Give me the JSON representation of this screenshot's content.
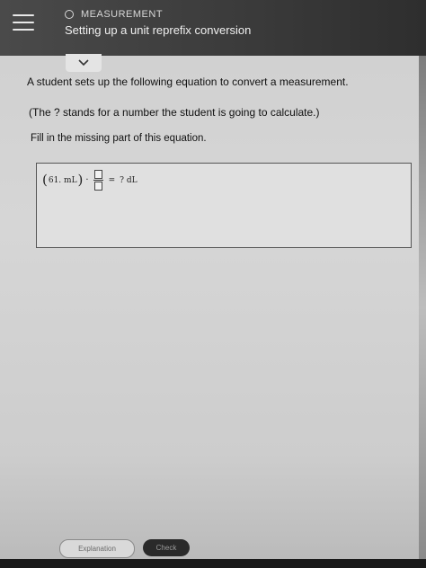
{
  "header": {
    "topic": "MEASUREMENT",
    "title": "Setting up a unit reprefix conversion"
  },
  "content": {
    "line1": "A student sets up the following equation to convert a measurement.",
    "line2": "(The ? stands for a number the student is going to calculate.)",
    "line3": "Fill in the missing part of this equation."
  },
  "equation": {
    "left_paren": "(",
    "value": "61. mL",
    "right_paren": ")",
    "dot": "·",
    "equals": "=",
    "result": "? dL"
  },
  "footer": {
    "explanation_label": "Explanation",
    "check_label": "Check"
  },
  "icons": {
    "menu": "menu-icon",
    "chevron": "chevron-down-icon",
    "topic_marker": "circle-icon"
  }
}
